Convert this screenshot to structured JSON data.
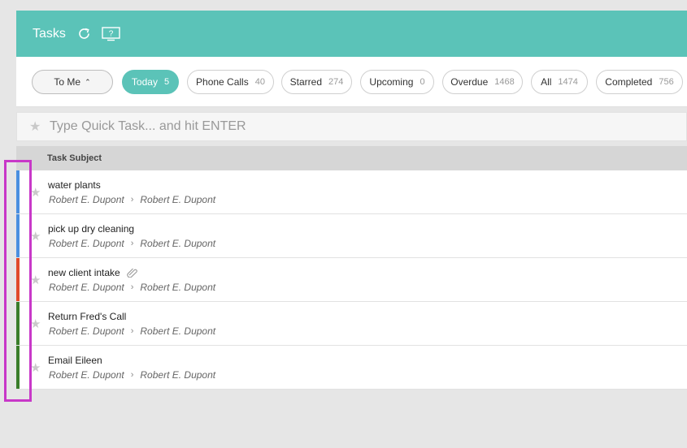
{
  "header": {
    "title": "Tasks",
    "help_label": "?"
  },
  "filters": {
    "to_me": "To Me",
    "pills": [
      {
        "label": "Today",
        "count": "5",
        "active": true
      },
      {
        "label": "Phone Calls",
        "count": "40"
      },
      {
        "label": "Starred",
        "count": "274"
      },
      {
        "label": "Upcoming",
        "count": "0"
      },
      {
        "label": "Overdue",
        "count": "1468"
      },
      {
        "label": "All",
        "count": "1474"
      },
      {
        "label": "Completed",
        "count": "756"
      }
    ]
  },
  "quick_task": {
    "placeholder": "Type Quick Task... and hit ENTER"
  },
  "table": {
    "column_header": "Task Subject",
    "rows": [
      {
        "subject": "water plants",
        "from": "Robert E. Dupont",
        "to": "Robert E. Dupont",
        "color": "#4a8fe0",
        "attachment": false
      },
      {
        "subject": "pick up dry cleaning",
        "from": "Robert E. Dupont",
        "to": "Robert E. Dupont",
        "color": "#4a8fe0",
        "attachment": false
      },
      {
        "subject": "new client intake",
        "from": "Robert E. Dupont",
        "to": "Robert E. Dupont",
        "color": "#e04a2a",
        "attachment": true
      },
      {
        "subject": "Return Fred's Call",
        "from": "Robert E. Dupont",
        "to": "Robert E. Dupont",
        "color": "#3a7d2a",
        "attachment": false
      },
      {
        "subject": "Email Eileen",
        "from": "Robert E. Dupont",
        "to": "Robert E. Dupont",
        "color": "#3a7d2a",
        "attachment": false
      }
    ]
  },
  "colors": {
    "accent": "#5bc3b8",
    "highlight": "#c838c8"
  }
}
